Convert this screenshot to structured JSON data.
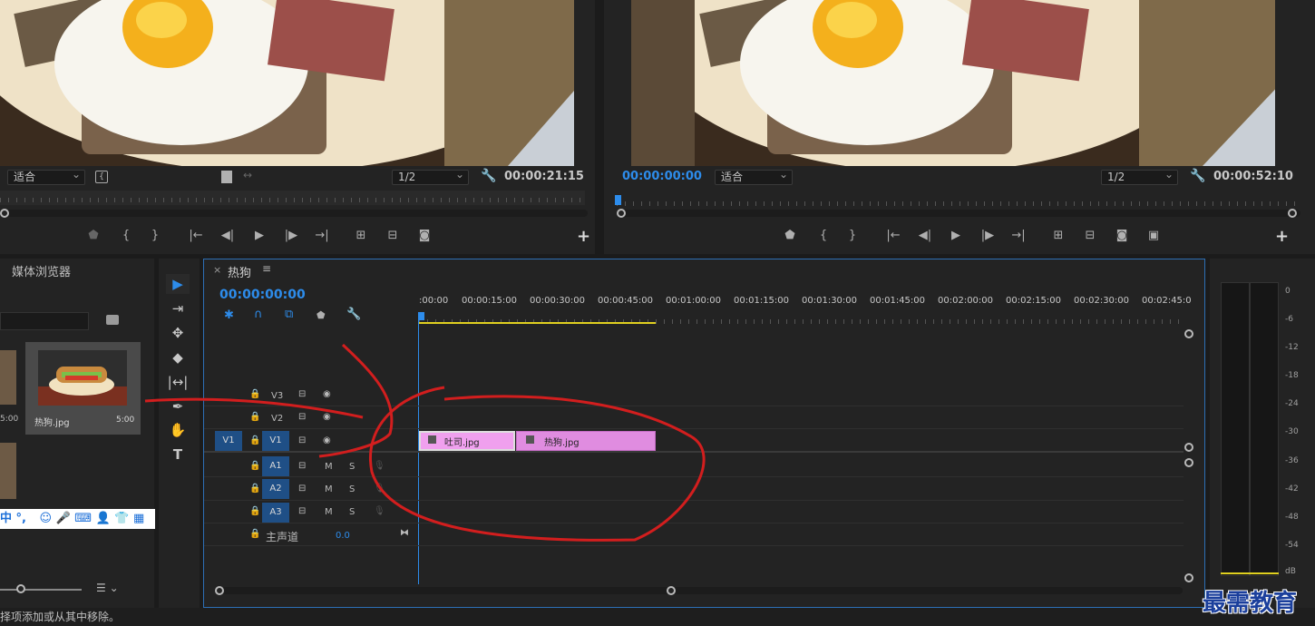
{
  "source_monitor": {
    "fit": "适合",
    "resolution": "1/2",
    "timecode": "00:00:21:15"
  },
  "program_monitor": {
    "current_time": "00:00:00:00",
    "fit": "适合",
    "resolution": "1/2",
    "duration": "00:00:52:10"
  },
  "project_panel": {
    "tab": "媒体浏览器",
    "items": [
      {
        "name": "热狗.jpg",
        "duration": "5:00"
      }
    ],
    "left_item_duration": "5:00",
    "ime_bar": "中 °,"
  },
  "timeline": {
    "sequence_name": "热狗",
    "current_time": "00:00:00:00",
    "ruler_labels": [
      ":00:00",
      "00:00:15:00",
      "00:00:30:00",
      "00:00:45:00",
      "00:01:00:00",
      "00:01:15:00",
      "00:01:30:00",
      "00:01:45:00",
      "00:02:00:00",
      "00:02:15:00",
      "00:02:30:00",
      "00:02:45:0"
    ],
    "video_tracks": [
      "V3",
      "V2",
      "V1"
    ],
    "source_patch": "V1",
    "audio_tracks": [
      "A1",
      "A2",
      "A3"
    ],
    "mute_label": "M",
    "solo_label": "S",
    "master_label": "主声道",
    "master_value": "0.0",
    "clips": [
      {
        "name": "吐司.jpg",
        "track": "V1"
      },
      {
        "name": "热狗.jpg",
        "track": "V1"
      }
    ]
  },
  "audio_meter": {
    "scale": [
      "0",
      "-6",
      "-12",
      "-18",
      "-24",
      "-30",
      "-36",
      "-42",
      "-48",
      "-54",
      "dB"
    ]
  },
  "status_bar": {
    "text": "择项添加或从其中移除。"
  },
  "watermark": "最需教育",
  "colors": {
    "accent_blue": "#2d8ceb",
    "clip_pink": "#e08ce0",
    "annotation_red": "#d21e1e"
  }
}
